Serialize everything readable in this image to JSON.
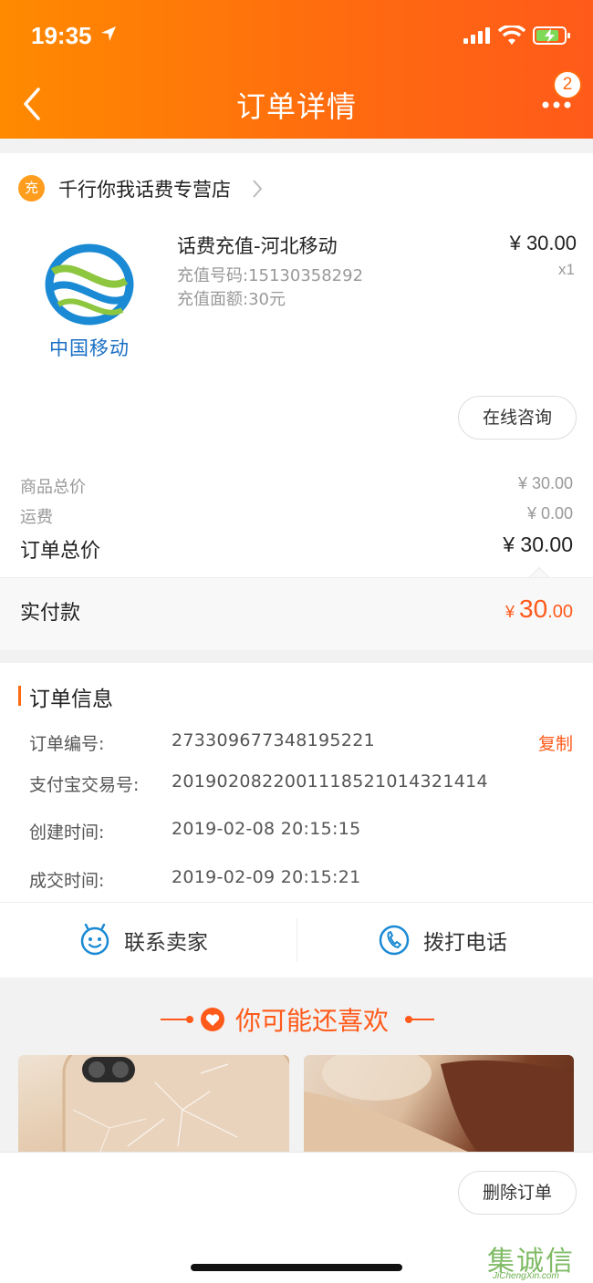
{
  "status_bar": {
    "time": "19:35"
  },
  "header": {
    "title": "订单详情",
    "badge_count": "2"
  },
  "store": {
    "icon_label": "充",
    "name": "千行你我话费专营店"
  },
  "product": {
    "logo_text": "中国移动",
    "title": "话费充值-河北移动",
    "recharge_number": "充值号码:15130358292",
    "recharge_amount": "充值面额:30元",
    "price": "¥ 30.00",
    "quantity": "x1",
    "consult_button": "在线咨询"
  },
  "price_summary": {
    "goods_total_label": "商品总价",
    "goods_total_value": "¥ 30.00",
    "shipping_label": "运费",
    "shipping_value": "¥ 0.00",
    "order_total_label": "订单总价",
    "order_total_value": "¥ 30.00",
    "paid_label": "实付款",
    "paid_symbol": "¥ ",
    "paid_int": "30",
    "paid_dec": ".00"
  },
  "order_info": {
    "section_title": "订单信息",
    "order_no_label": "订单编号:",
    "order_no_value": "273309677348195221",
    "copy_button": "复制",
    "alipay_no_label": "支付宝交易号:",
    "alipay_no_value": "2019020822001118521014321414",
    "created_label": "创建时间:",
    "created_value": "2019-02-08 20:15:15",
    "completed_label": "成交时间:",
    "completed_value": "2019-02-09 20:15:21"
  },
  "actions": {
    "contact_seller": "联系卖家",
    "call_phone": "拨打电话"
  },
  "recommend": {
    "title": "你可能还喜欢"
  },
  "bottom": {
    "delete_button": "删除订单"
  },
  "watermark": {
    "text": "集诚信",
    "sub": "JiChengXin.com"
  },
  "colors": {
    "accent": "#ff6a10",
    "price_red": "#ff5a1a",
    "blue": "#1a8ad4"
  }
}
